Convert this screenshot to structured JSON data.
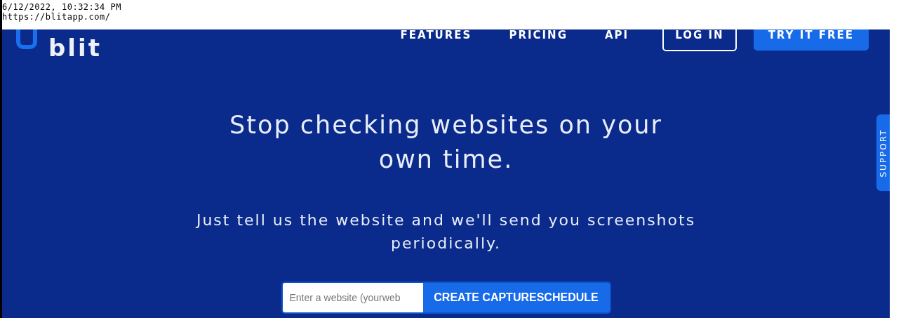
{
  "capture_header": {
    "timestamp": "6/12/2022, 10:32:34 PM",
    "url": "https://blitapp.com/"
  },
  "navbar": {
    "logo_text": "blit",
    "links": [
      "FEATURES",
      "PRICING",
      "API"
    ],
    "login_button": "LOG IN",
    "cta_button": "TRY IT FREE"
  },
  "hero": {
    "headline": "Stop checking websites on your own time.",
    "subtitle": "Just tell us the website and we'll send you screenshots periodically.",
    "input": {
      "placeholder": "Enter a website (yourweb"
    },
    "submit_button": "CREATE CAPTURESCHEDULE"
  },
  "support_tab": "SUPPORT"
}
